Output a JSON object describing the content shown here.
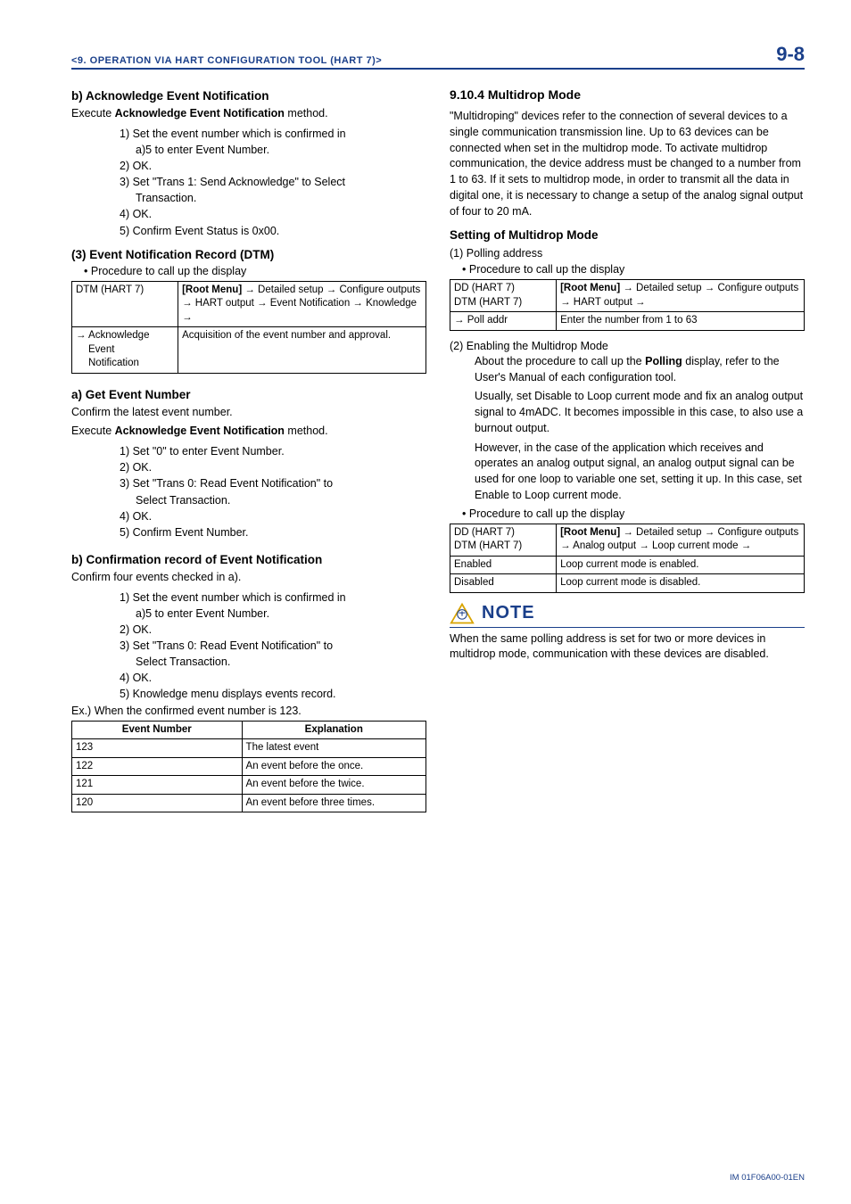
{
  "header": {
    "title": "<9.  OPERATION VIA HART CONFIGURATION TOOL (HART 7)>",
    "page": "9-8"
  },
  "left": {
    "b_ack": {
      "heading": "b)   Acknowledge Event Notification",
      "intro1": "Execute ",
      "intro_bold": "Acknowledge Event Notification",
      "intro2": " method.",
      "steps": {
        "s1a": "1) Set the event number which is confirmed in",
        "s1b": "a)5 to enter Event Number.",
        "s2": "2) OK.",
        "s3a": "3) Set \"Trans 1: Send Acknowledge\" to Select",
        "s3b": "Transaction.",
        "s4": "4) OK.",
        "s5": "5) Confirm Event Status is 0x00."
      }
    },
    "rec": {
      "heading": "(3) Event Notification Record (DTM)",
      "bullet": "Procedure to call up the display",
      "table": {
        "r1c1": "DTM (HART 7)",
        "r1c2_bold": "[Root Menu]",
        "r1c2_rest": " → Detailed setup → Configure outputs → HART output → Event Notification → Knowledge →",
        "r2c1": "→ Acknowledge",
        "r2c1b": "Event",
        "r2c1c": "Notification",
        "r2c2": "Acquisition of the event number and approval."
      }
    },
    "a_get": {
      "heading": "a)   Get Event Number",
      "line1": "Confirm the latest event number.",
      "line2a": "Execute ",
      "line2_bold": "Acknowledge Event Notification",
      "line2b": " method.",
      "steps": {
        "s1": "1) Set \"0\" to enter Event Number.",
        "s2": "2) OK.",
        "s3a": "3) Set \"Trans 0: Read Event Notification\" to",
        "s3b": "Select Transaction.",
        "s4": "4) OK.",
        "s5": "5) Confirm Event Number."
      }
    },
    "b_conf": {
      "heading": "b)   Confirmation record of Event Notification",
      "line1": "Confirm four events checked in a).",
      "steps": {
        "s1a": "1) Set the event number which is confirmed in",
        "s1b": "a)5 to enter Event Number.",
        "s2": "2) OK.",
        "s3a": "3) Set \"Trans 0: Read Event Notification\" to",
        "s3b": "Select Transaction.",
        "s4": "4) OK.",
        "s5": "5) Knowledge menu displays events record."
      },
      "ex": "Ex.) When the confirmed event number is 123.",
      "table": {
        "h1": "Event Number",
        "h2": "Explanation",
        "r1c1": "123",
        "r1c2": "The latest event",
        "r2c1": "122",
        "r2c2": "An event before the once.",
        "r3c1": "121",
        "r3c2": "An event before the twice.",
        "r4c1": "120",
        "r4c2": "An event before three times."
      }
    }
  },
  "right": {
    "multidrop": {
      "heading": "9.10.4  Multidrop Mode",
      "para": "\"Multidroping\" devices refer to the connection of several devices to a single communication transmission line. Up to 63 devices can be connected when set in the multidrop mode. To activate multidrop communication, the device address must be changed to a number from 1 to 63. If it sets to multidrop mode, in order to transmit all the data in digital one, it is necessary to change a setup of the analog signal output of four to 20 mA."
    },
    "setting": {
      "heading": "Setting of Multidrop Mode",
      "p1": "(1)  Polling address",
      "bullet1": "Procedure to call up the display",
      "table1": {
        "r1c1a": "DD (HART 7)",
        "r1c1b": "DTM (HART 7)",
        "r1c2_bold": "[Root Menu]",
        "r1c2_rest": " → Detailed setup → Configure outputs → HART output →",
        "r2c1": "→ Poll addr",
        "r2c2": "Enter the number from 1 to 63"
      },
      "p2": "(2)  Enabling the Multidrop Mode",
      "p2body1a": "About the procedure to call up the ",
      "p2body1_bold": "Polling",
      "p2body1b": " display, refer to the User's Manual of each configuration tool.",
      "p2body2": "Usually, set Disable to Loop current mode and fix an analog output signal to 4mADC. It becomes impossible in this case, to also use a burnout output.",
      "p2body3": "However, in the case of the application which receives and operates an analog output signal, an analog output signal can be used for one loop to variable one set, setting it up. In this case, set Enable to Loop current mode.",
      "bullet2": "Procedure to call up the display",
      "table2": {
        "r1c1a": "DD (HART 7)",
        "r1c1b": "DTM (HART 7)",
        "r1c2_bold": "[Root Menu]",
        "r1c2_rest": " → Detailed setup → Configure outputs → Analog output → Loop current mode →",
        "r2c1": "Enabled",
        "r2c2": "Loop current mode is enabled.",
        "r3c1": "Disabled",
        "r3c2": "Loop current mode is disabled."
      }
    },
    "note": {
      "label": "NOTE",
      "text": "When the same polling address is set for two or more devices in multidrop mode, communication with these devices are disabled."
    }
  },
  "footer": "IM 01F06A00-01EN"
}
